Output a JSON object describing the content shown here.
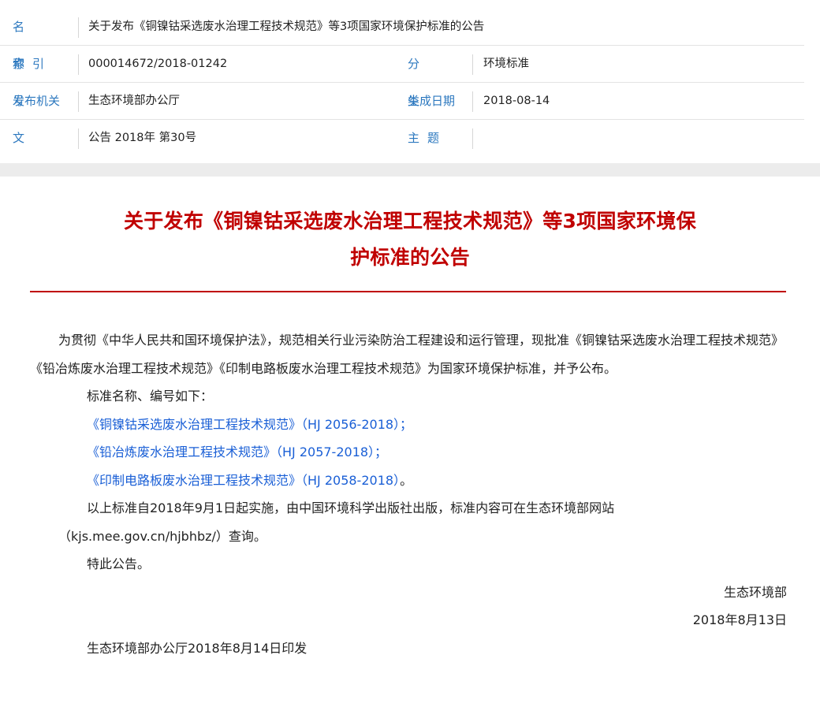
{
  "meta": {
    "name_label": "名称",
    "name_value": "关于发布《铜镍钴采选废水治理工程技术规范》等3项国家环境保护标准的公告",
    "index_label": "索引号",
    "index_value": "000014672/2018-01242",
    "category_label": "分类",
    "category_value": "环境标准",
    "issuer_label": "发布机关",
    "issuer_value": "生态环境部办公厅",
    "date_label": "生成日期",
    "date_value": "2018-08-14",
    "docno_label": "文号",
    "docno_value": "公告 2018年 第30号",
    "keywords_label": "主题词",
    "keywords_value": ""
  },
  "article": {
    "title_line1": "关于发布《铜镍钴采选废水治理工程技术规范》等3项国家环境保",
    "title_line2": "护标准的公告",
    "para1": "为贯彻《中华人民共和国环境保护法》，规范相关行业污染防治工程建设和运行管理，现批准《铜镍钴采选废水治理工程技术规范》《铅冶炼废水治理工程技术规范》《印制电路板废水治理工程技术规范》为国家环境保护标准，并予公布。",
    "para2": "标准名称、编号如下：",
    "link1": "《铜镍钴采选废水治理工程技术规范》（HJ 2056-2018）；",
    "link2": "《铅冶炼废水治理工程技术规范》（HJ 2057-2018）；",
    "link3": "《印制电路板废水治理工程技术规范》（HJ 2058-2018）",
    "link3_suffix": "。",
    "para3_line1": "以上标准自2018年9月1日起实施，由中国环境科学出版社出版，标准内容可在生态环境部网站",
    "para3_line2": "（kjs.mee.gov.cn/hjbhbz/）查询。",
    "para4": "特此公告。",
    "signature_org": "生态环境部",
    "signature_date": "2018年8月13日",
    "footer": "生态环境部办公厅2018年8月14日印发"
  }
}
